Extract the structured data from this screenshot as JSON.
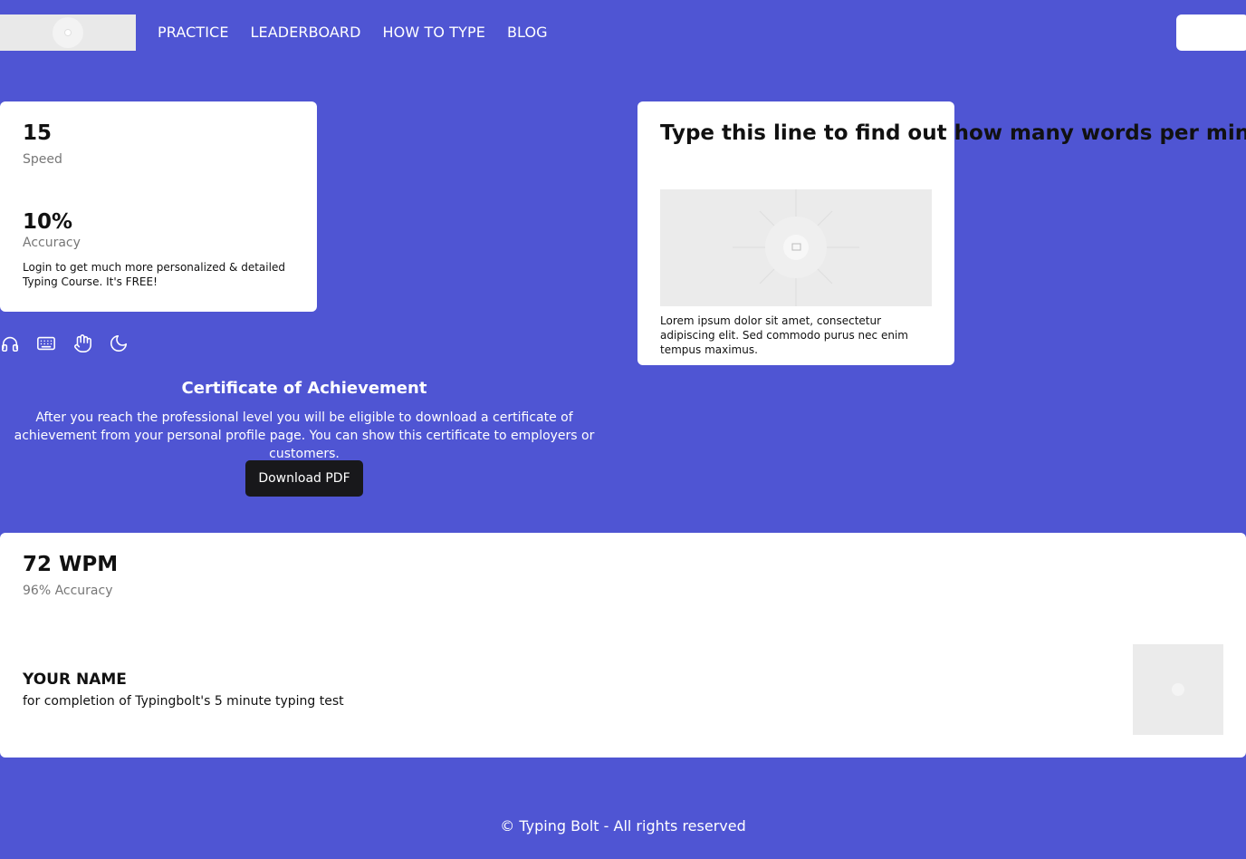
{
  "nav": {
    "items": [
      "PRACTICE",
      "LEADERBOARD",
      "HOW TO TYPE",
      "BLOG"
    ]
  },
  "stats": {
    "speed_value": "15",
    "speed_label": "Speed",
    "accuracy_value": "10%",
    "accuracy_label": "Accuracy",
    "login_note": "Login to get much more personalized & detailed Typing Course. It's FREE!"
  },
  "typing_line": {
    "title": "Type this line to find out how many words per minute or wpm",
    "caption": "Lorem ipsum dolor sit amet, consectetur adipiscing elit. Sed commodo purus nec enim tempus maximus."
  },
  "toolbar_icons": [
    "headphones-icon",
    "keyboard-icon",
    "hand-icon",
    "moon-icon"
  ],
  "certificate": {
    "title": "Certificate of Achievement",
    "text": "After you reach the professional level you will be eligible to download a certificate of achievement from your personal profile page. You can show this certificate to employers or customers.",
    "button_label": "Download PDF"
  },
  "result": {
    "wpm": "72 WPM",
    "accuracy": "96% Accuracy",
    "name": "YOUR NAME",
    "completion": "for completion of Typingbolt's 5 minute typing test"
  },
  "footer": {
    "text": "© Typing Bolt - All rights reserved"
  },
  "colors": {
    "background": "#4f55d3",
    "card": "#ffffff",
    "button_dark": "#18181b"
  }
}
